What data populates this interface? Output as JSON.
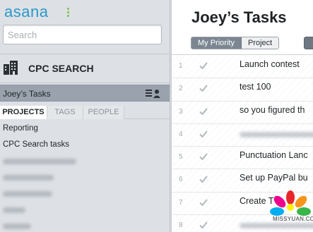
{
  "app": {
    "logo_text": "asana",
    "search": {
      "placeholder": "Search",
      "value": ""
    }
  },
  "sidebar": {
    "workspace_name": "CPC SEARCH",
    "my_tasks_label": "Joey’s Tasks",
    "tabs": [
      {
        "label": "PROJECTS",
        "active": true
      },
      {
        "label": "TAGS",
        "active": false
      },
      {
        "label": "PEOPLE",
        "active": false
      }
    ],
    "projects": [
      {
        "label": "Reporting",
        "blurred": false
      },
      {
        "label": "CPC Search tasks",
        "blurred": false
      },
      {
        "label": "",
        "blurred": true
      },
      {
        "label": "",
        "blurred": true
      },
      {
        "label": "",
        "blurred": true
      },
      {
        "label": "",
        "blurred": true
      },
      {
        "label": "",
        "blurred": true
      }
    ]
  },
  "main": {
    "title": "Joey’s Tasks",
    "toolbar": {
      "my_priority_label": "My Priority",
      "project_label": "Project"
    },
    "tasks": [
      {
        "number": "1",
        "name": "Launch contest",
        "blurred": false
      },
      {
        "number": "2",
        "name": "test 100",
        "blurred": false
      },
      {
        "number": "3",
        "name": "so  you figured th",
        "blurred": false
      },
      {
        "number": "4",
        "name": "",
        "blurred": true
      },
      {
        "number": "5",
        "name": "Punctuation Lanc",
        "blurred": false
      },
      {
        "number": "6",
        "name": "Set up PayPal bu",
        "blurred": false
      },
      {
        "number": "7",
        "name": "Create T",
        "blurred": false
      },
      {
        "number": "8",
        "name": "",
        "blurred": true
      }
    ]
  },
  "watermark": {
    "text": "MISSYUAN.COM"
  },
  "colors": {
    "sidebar_bg": "#dde1e5",
    "selected_row_bg": "#9aa3ad",
    "logo_blue": "#2d98c8",
    "logo_green": "#7ac143",
    "active_button_bg": "#7b8692"
  }
}
